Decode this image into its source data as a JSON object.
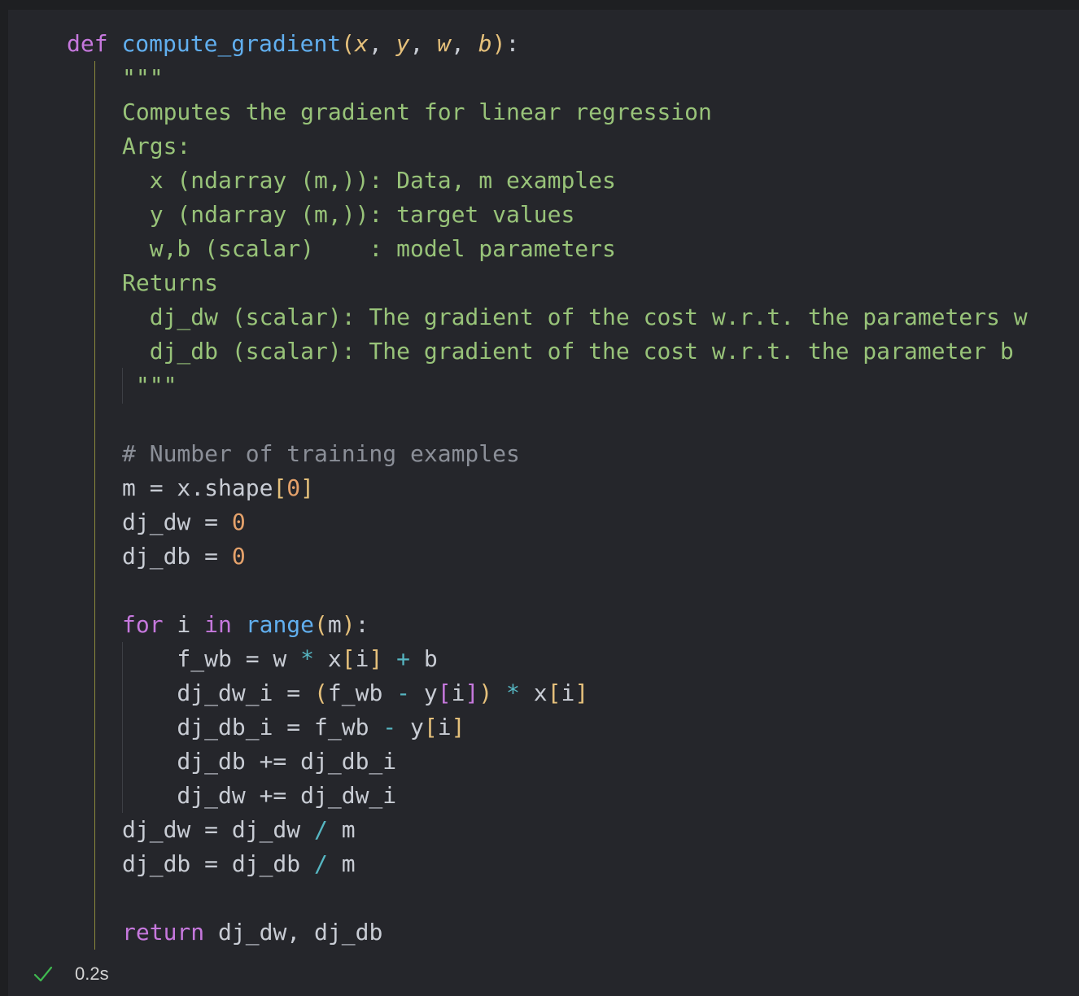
{
  "code": {
    "lines": [
      [
        [
          "def",
          "kw-def"
        ],
        [
          " ",
          "plain"
        ],
        [
          "compute_gradient",
          "fn"
        ],
        [
          "(",
          "paren1"
        ],
        [
          "x",
          "param"
        ],
        [
          ", ",
          "plain"
        ],
        [
          "y",
          "param"
        ],
        [
          ", ",
          "plain"
        ],
        [
          "w",
          "param"
        ],
        [
          ", ",
          "plain"
        ],
        [
          "b",
          "param"
        ],
        [
          ")",
          "paren1"
        ],
        [
          ":",
          "plain"
        ]
      ],
      [
        [
          "\"\"\"",
          "doc"
        ]
      ],
      [
        [
          "Computes the gradient for linear regression",
          "doc"
        ]
      ],
      [
        [
          "Args:",
          "doc"
        ]
      ],
      [
        [
          "  x (ndarray (m,)): Data, m examples",
          "doc"
        ]
      ],
      [
        [
          "  y (ndarray (m,)): target values",
          "doc"
        ]
      ],
      [
        [
          "  w,b (scalar)    : model parameters",
          "doc"
        ]
      ],
      [
        [
          "Returns",
          "doc"
        ]
      ],
      [
        [
          "  dj_dw (scalar): The gradient of the cost w.r.t. the parameters w",
          "doc"
        ]
      ],
      [
        [
          "  dj_db (scalar): The gradient of the cost w.r.t. the parameter b",
          "doc"
        ]
      ],
      [
        [
          " \"\"\"",
          "doc"
        ]
      ],
      [],
      [
        [
          "# Number of training examples",
          "comment"
        ]
      ],
      [
        [
          "m = x.shape",
          "plain"
        ],
        [
          "[",
          "paren1"
        ],
        [
          "0",
          "num"
        ],
        [
          "]",
          "paren1"
        ]
      ],
      [
        [
          "dj_dw = ",
          "plain"
        ],
        [
          "0",
          "num"
        ]
      ],
      [
        [
          "dj_db = ",
          "plain"
        ],
        [
          "0",
          "num"
        ]
      ],
      [],
      [
        [
          "for",
          "kw"
        ],
        [
          " i ",
          "plain"
        ],
        [
          "in",
          "kw"
        ],
        [
          " ",
          "plain"
        ],
        [
          "range",
          "builtin"
        ],
        [
          "(",
          "paren1"
        ],
        [
          "m",
          "plain"
        ],
        [
          ")",
          "paren1"
        ],
        [
          ":",
          "plain"
        ]
      ],
      [
        [
          "    f_wb = w ",
          "plain"
        ],
        [
          "*",
          "op"
        ],
        [
          " x",
          "plain"
        ],
        [
          "[",
          "paren1"
        ],
        [
          "i",
          "plain"
        ],
        [
          "]",
          "paren1"
        ],
        [
          " ",
          "plain"
        ],
        [
          "+",
          "op"
        ],
        [
          " b",
          "plain"
        ]
      ],
      [
        [
          "    dj_dw_i = ",
          "plain"
        ],
        [
          "(",
          "paren1"
        ],
        [
          "f_wb ",
          "plain"
        ],
        [
          "-",
          "op"
        ],
        [
          " y",
          "plain"
        ],
        [
          "[",
          "paren2"
        ],
        [
          "i",
          "plain"
        ],
        [
          "]",
          "paren2"
        ],
        [
          ")",
          "paren1"
        ],
        [
          " ",
          "plain"
        ],
        [
          "*",
          "op"
        ],
        [
          " x",
          "plain"
        ],
        [
          "[",
          "paren1"
        ],
        [
          "i",
          "plain"
        ],
        [
          "]",
          "paren1"
        ]
      ],
      [
        [
          "    dj_db_i = f_wb ",
          "plain"
        ],
        [
          "-",
          "op"
        ],
        [
          " y",
          "plain"
        ],
        [
          "[",
          "paren1"
        ],
        [
          "i",
          "plain"
        ],
        [
          "]",
          "paren1"
        ]
      ],
      [
        [
          "    dj_db += dj_db_i",
          "plain"
        ]
      ],
      [
        [
          "    dj_dw += dj_dw_i",
          "plain"
        ]
      ],
      [
        [
          "dj_dw = dj_dw ",
          "plain"
        ],
        [
          "/",
          "op"
        ],
        [
          " m",
          "plain"
        ]
      ],
      [
        [
          "dj_db = dj_db ",
          "plain"
        ],
        [
          "/",
          "op"
        ],
        [
          " m",
          "plain"
        ]
      ],
      [],
      [
        [
          "return",
          "kw"
        ],
        [
          " dj_dw, dj_db",
          "plain"
        ]
      ]
    ]
  },
  "status": {
    "icon": "checkmark-icon",
    "check_color": "#3fb950",
    "duration": "0.2s"
  }
}
